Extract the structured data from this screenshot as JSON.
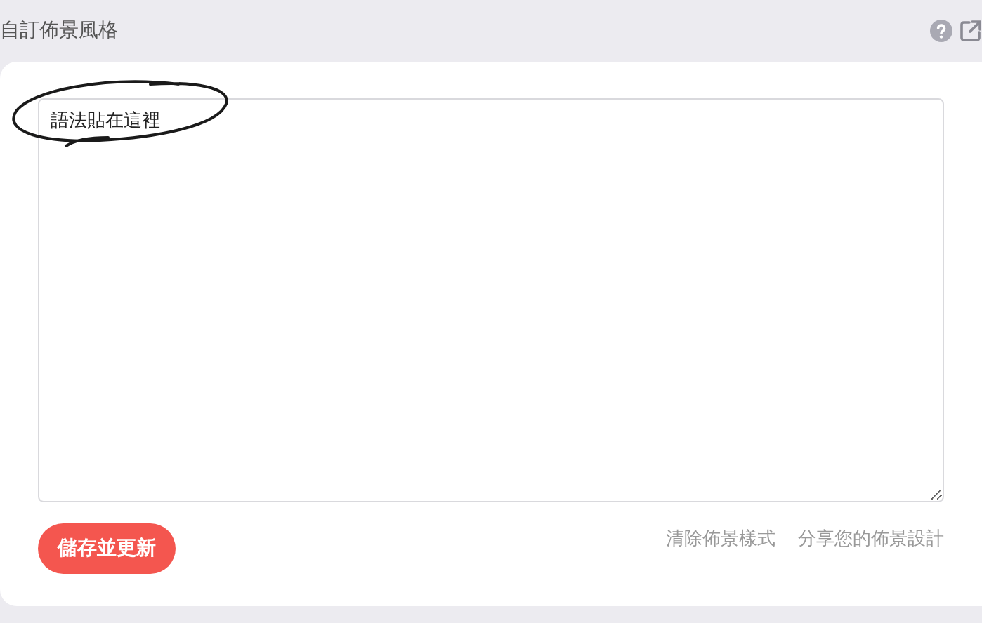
{
  "section": {
    "title": "自訂佈景風格"
  },
  "editor": {
    "placeholder": "語法貼在這裡"
  },
  "save_button": {
    "label": "儲存並更新"
  },
  "links": [
    "清除佈景樣式",
    "分享您的佈景設計"
  ]
}
